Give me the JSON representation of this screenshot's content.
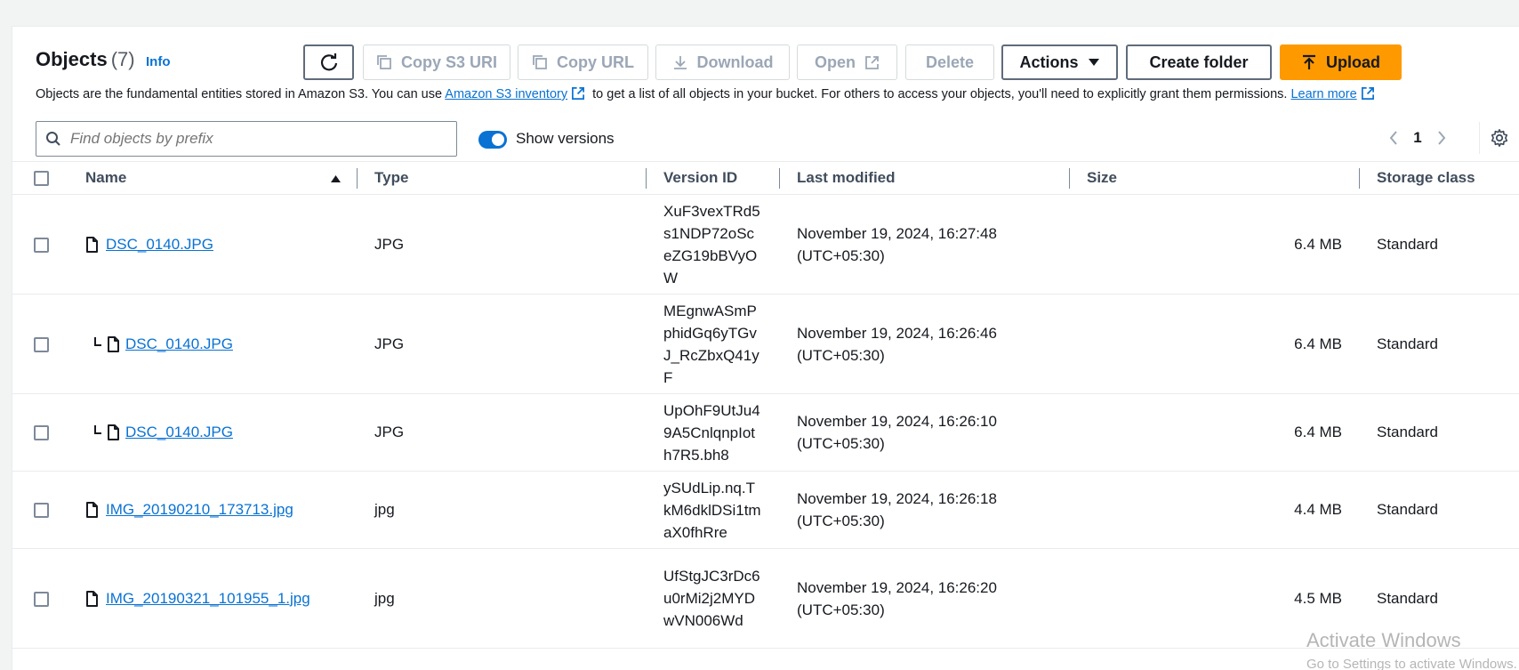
{
  "header": {
    "title": "Objects",
    "count": "(7)",
    "info": "Info"
  },
  "toolbar": {
    "copy_s3_uri": "Copy S3 URI",
    "copy_url": "Copy URL",
    "download": "Download",
    "open": "Open",
    "delete": "Delete",
    "actions": "Actions",
    "create_folder": "Create folder",
    "upload": "Upload"
  },
  "description": {
    "part1": "Objects are the fundamental entities stored in Amazon S3. You can use",
    "inventory_link": "Amazon S3 inventory",
    "part2": "to get a list of all objects in your bucket. For others to access your objects, you'll need to explicitly grant them permissions.",
    "learn_more": "Learn more"
  },
  "search": {
    "placeholder": "Find objects by prefix",
    "value": ""
  },
  "show_versions": {
    "label": "Show versions",
    "enabled": true
  },
  "pagination": {
    "current_page": "1"
  },
  "table": {
    "columns": [
      "Name",
      "Type",
      "Version ID",
      "Last modified",
      "Size",
      "Storage class"
    ],
    "sorted_column": "Name",
    "sort_direction": "ascending",
    "rows": [
      {
        "name": "DSC_0140.JPG",
        "is_version": false,
        "type": "JPG",
        "version_id": "XuF3vexTRd5s1NDP72oSceZG19bBVyOW",
        "last_modified": "November 19, 2024, 16:27:48",
        "tz": "(UTC+05:30)",
        "size": "6.4 MB",
        "storage_class": "Standard"
      },
      {
        "name": "DSC_0140.JPG",
        "is_version": true,
        "type": "JPG",
        "version_id": "MEgnwASmPphidGq6yTGvJ_RcZbxQ41yF",
        "last_modified": "November 19, 2024, 16:26:46",
        "tz": "(UTC+05:30)",
        "size": "6.4 MB",
        "storage_class": "Standard"
      },
      {
        "name": "DSC_0140.JPG",
        "is_version": true,
        "type": "JPG",
        "version_id": "UpOhF9UtJu49A5CnlqnpIoth7R5.bh8",
        "last_modified": "November 19, 2024, 16:26:10",
        "tz": "(UTC+05:30)",
        "size": "6.4 MB",
        "storage_class": "Standard"
      },
      {
        "name": "IMG_20190210_173713.jpg",
        "is_version": false,
        "type": "jpg",
        "version_id": "ySUdLip.nq.TkM6dklDSi1tmaX0fhRre",
        "last_modified": "November 19, 2024, 16:26:18",
        "tz": "(UTC+05:30)",
        "size": "4.4 MB",
        "storage_class": "Standard"
      },
      {
        "name": "IMG_20190321_101955_1.jpg",
        "is_version": false,
        "type": "jpg",
        "version_id": "UfStgJC3rDc6u0rMi2j2MYDwVN006Wd",
        "last_modified": "November 19, 2024, 16:26:20",
        "tz": "(UTC+05:30)",
        "size": "4.5 MB",
        "storage_class": "Standard"
      }
    ]
  },
  "watermark": {
    "line1": "Activate Windows",
    "line2": "Go to Settings to activate Windows."
  },
  "colors": {
    "accent": "#0972d3",
    "upload": "#ff9900",
    "text": "#16191f",
    "disabled": "#9ba7b6"
  }
}
